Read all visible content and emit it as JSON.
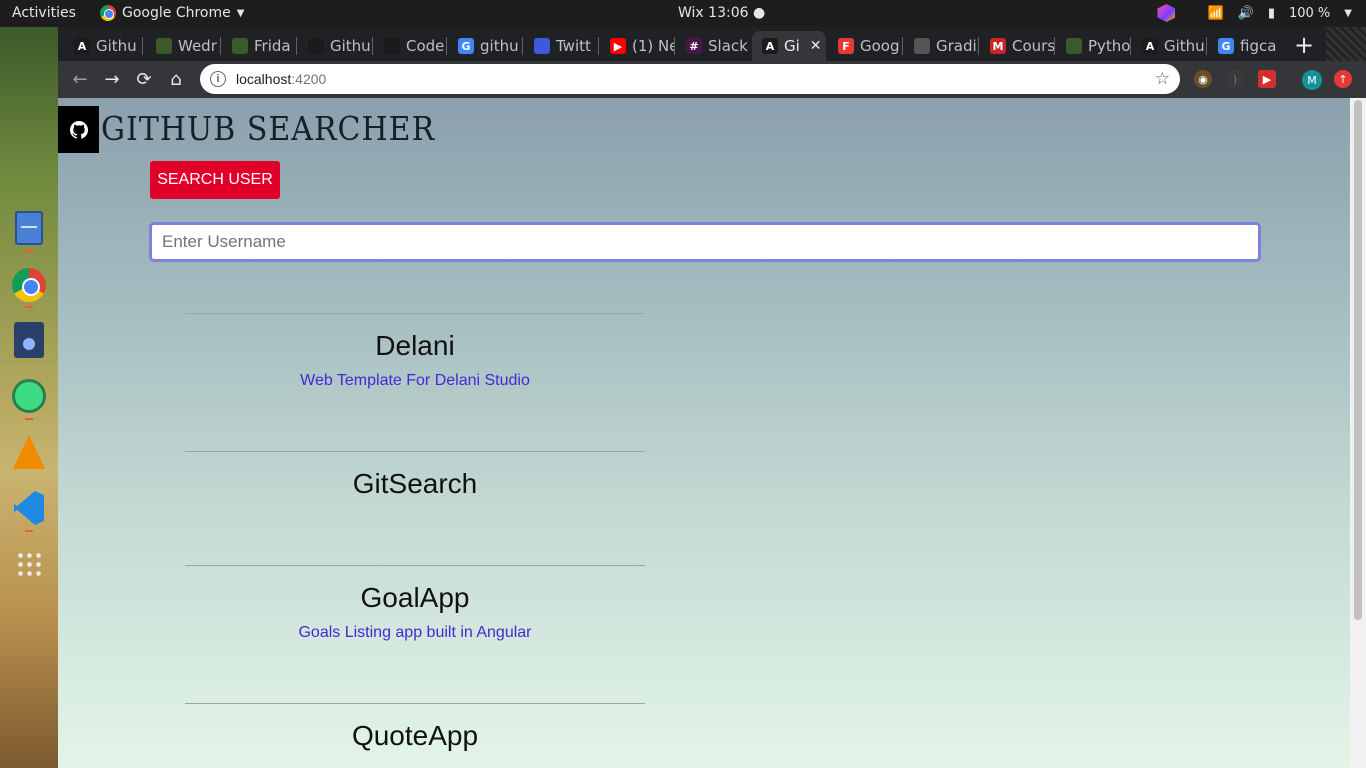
{
  "topbar": {
    "activities": "Activities",
    "app_name": "Google Chrome",
    "clock": "Wix 13:06 ●",
    "battery": "100 %"
  },
  "tabs": [
    {
      "label": "Githu",
      "favicon": "A",
      "color": "#1b1b1b"
    },
    {
      "label": "Wedr",
      "favicon": "",
      "color": "#3a5a2a"
    },
    {
      "label": "Frida",
      "favicon": "",
      "color": "#3a5a2a"
    },
    {
      "label": "Githu",
      "favicon": "",
      "color": "#1b1b1b"
    },
    {
      "label": "Code",
      "favicon": "",
      "color": "#1b1b1b"
    },
    {
      "label": "githu",
      "favicon": "G",
      "color": "#4285f4"
    },
    {
      "label": "Twitt",
      "favicon": "",
      "color": "#3b5bdb"
    },
    {
      "label": "(1) Ne",
      "favicon": "▶",
      "color": "#ff0000"
    },
    {
      "label": "Slack",
      "favicon": "#",
      "color": "#4a154b"
    },
    {
      "label": "Gi",
      "favicon": "A",
      "color": "#1b1b1b",
      "active": true
    },
    {
      "label": "Goog",
      "favicon": "F",
      "color": "#e53935"
    },
    {
      "label": "Gradi",
      "favicon": "",
      "color": "#555555"
    },
    {
      "label": "Cours",
      "favicon": "M",
      "color": "#c62828"
    },
    {
      "label": "Pytho",
      "favicon": "",
      "color": "#3a5a2a"
    },
    {
      "label": "Githu",
      "favicon": "A",
      "color": "#1b1b1b"
    },
    {
      "label": "figca",
      "favicon": "G",
      "color": "#4285f4"
    }
  ],
  "omnibox": {
    "host": "localhost",
    "port": ":4200"
  },
  "profile_initial": "M",
  "app": {
    "title": "GITHUB SEARCHER",
    "search_button": "SEARCH USER",
    "search_placeholder": "Enter Username"
  },
  "repos": [
    {
      "name": "Delani",
      "description": "Web Template For Delani Studio"
    },
    {
      "name": "GitSearch",
      "description": ""
    },
    {
      "name": "GoalApp",
      "description": "Goals Listing app built in Angular"
    },
    {
      "name": "QuoteApp",
      "description": ""
    }
  ],
  "colors": {
    "accent_red": "#e0002a",
    "link_purple": "#4527d4",
    "input_focus": "#8080d8"
  }
}
